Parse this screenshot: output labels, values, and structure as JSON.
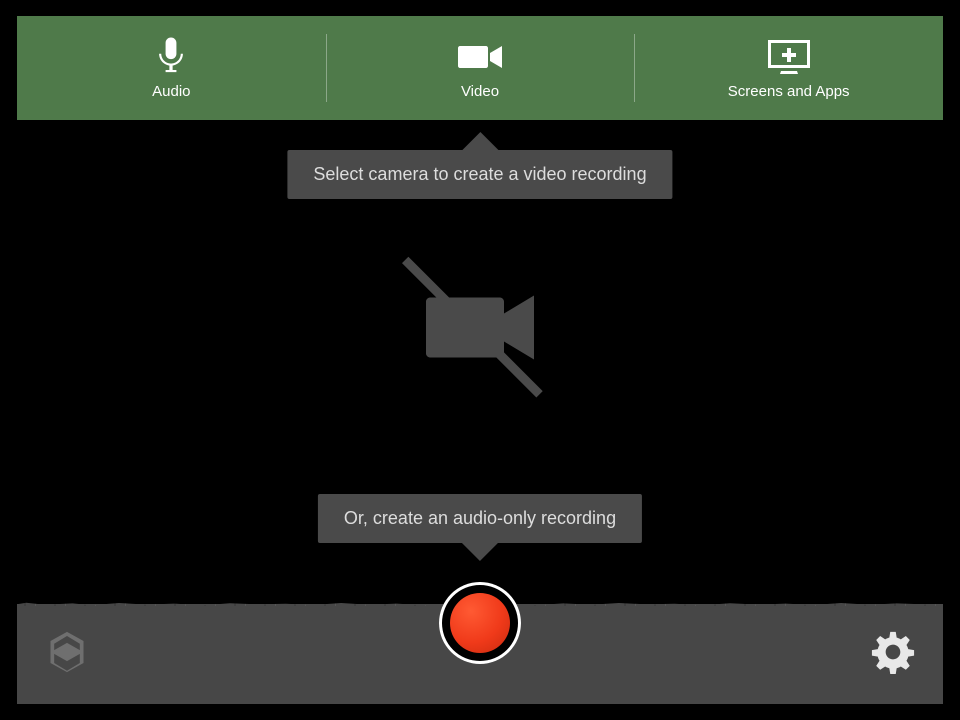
{
  "tabs": {
    "audio": {
      "label": "Audio"
    },
    "video": {
      "label": "Video"
    },
    "screens": {
      "label": "Screens and Apps"
    }
  },
  "tooltips": {
    "select_camera": "Select camera to create a video recording",
    "audio_only": "Or, create an audio-only recording"
  }
}
